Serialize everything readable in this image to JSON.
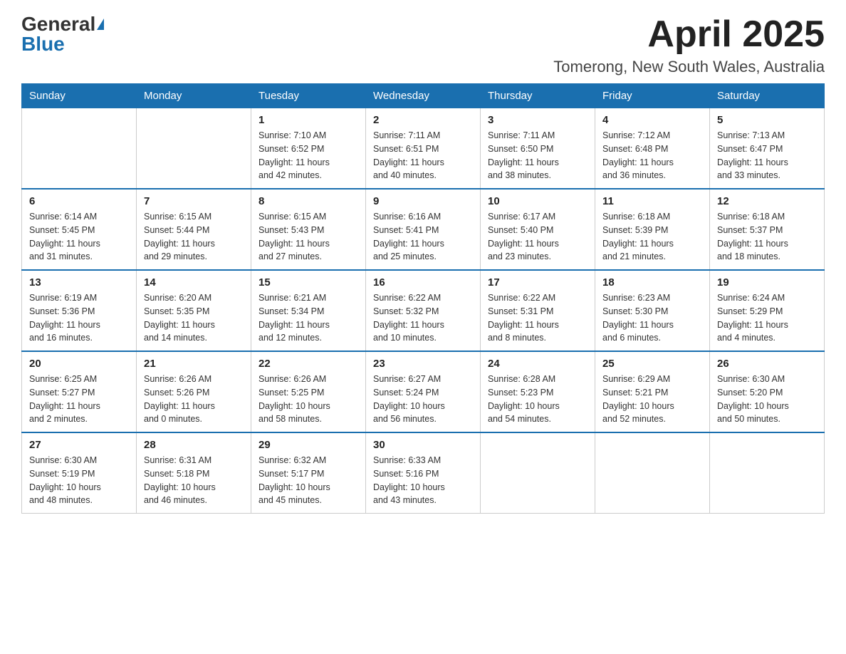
{
  "header": {
    "logo_general": "General",
    "logo_blue": "Blue",
    "title": "April 2025",
    "location": "Tomerong, New South Wales, Australia"
  },
  "weekdays": [
    "Sunday",
    "Monday",
    "Tuesday",
    "Wednesday",
    "Thursday",
    "Friday",
    "Saturday"
  ],
  "weeks": [
    [
      {
        "day": "",
        "info": ""
      },
      {
        "day": "",
        "info": ""
      },
      {
        "day": "1",
        "info": "Sunrise: 7:10 AM\nSunset: 6:52 PM\nDaylight: 11 hours\nand 42 minutes."
      },
      {
        "day": "2",
        "info": "Sunrise: 7:11 AM\nSunset: 6:51 PM\nDaylight: 11 hours\nand 40 minutes."
      },
      {
        "day": "3",
        "info": "Sunrise: 7:11 AM\nSunset: 6:50 PM\nDaylight: 11 hours\nand 38 minutes."
      },
      {
        "day": "4",
        "info": "Sunrise: 7:12 AM\nSunset: 6:48 PM\nDaylight: 11 hours\nand 36 minutes."
      },
      {
        "day": "5",
        "info": "Sunrise: 7:13 AM\nSunset: 6:47 PM\nDaylight: 11 hours\nand 33 minutes."
      }
    ],
    [
      {
        "day": "6",
        "info": "Sunrise: 6:14 AM\nSunset: 5:45 PM\nDaylight: 11 hours\nand 31 minutes."
      },
      {
        "day": "7",
        "info": "Sunrise: 6:15 AM\nSunset: 5:44 PM\nDaylight: 11 hours\nand 29 minutes."
      },
      {
        "day": "8",
        "info": "Sunrise: 6:15 AM\nSunset: 5:43 PM\nDaylight: 11 hours\nand 27 minutes."
      },
      {
        "day": "9",
        "info": "Sunrise: 6:16 AM\nSunset: 5:41 PM\nDaylight: 11 hours\nand 25 minutes."
      },
      {
        "day": "10",
        "info": "Sunrise: 6:17 AM\nSunset: 5:40 PM\nDaylight: 11 hours\nand 23 minutes."
      },
      {
        "day": "11",
        "info": "Sunrise: 6:18 AM\nSunset: 5:39 PM\nDaylight: 11 hours\nand 21 minutes."
      },
      {
        "day": "12",
        "info": "Sunrise: 6:18 AM\nSunset: 5:37 PM\nDaylight: 11 hours\nand 18 minutes."
      }
    ],
    [
      {
        "day": "13",
        "info": "Sunrise: 6:19 AM\nSunset: 5:36 PM\nDaylight: 11 hours\nand 16 minutes."
      },
      {
        "day": "14",
        "info": "Sunrise: 6:20 AM\nSunset: 5:35 PM\nDaylight: 11 hours\nand 14 minutes."
      },
      {
        "day": "15",
        "info": "Sunrise: 6:21 AM\nSunset: 5:34 PM\nDaylight: 11 hours\nand 12 minutes."
      },
      {
        "day": "16",
        "info": "Sunrise: 6:22 AM\nSunset: 5:32 PM\nDaylight: 11 hours\nand 10 minutes."
      },
      {
        "day": "17",
        "info": "Sunrise: 6:22 AM\nSunset: 5:31 PM\nDaylight: 11 hours\nand 8 minutes."
      },
      {
        "day": "18",
        "info": "Sunrise: 6:23 AM\nSunset: 5:30 PM\nDaylight: 11 hours\nand 6 minutes."
      },
      {
        "day": "19",
        "info": "Sunrise: 6:24 AM\nSunset: 5:29 PM\nDaylight: 11 hours\nand 4 minutes."
      }
    ],
    [
      {
        "day": "20",
        "info": "Sunrise: 6:25 AM\nSunset: 5:27 PM\nDaylight: 11 hours\nand 2 minutes."
      },
      {
        "day": "21",
        "info": "Sunrise: 6:26 AM\nSunset: 5:26 PM\nDaylight: 11 hours\nand 0 minutes."
      },
      {
        "day": "22",
        "info": "Sunrise: 6:26 AM\nSunset: 5:25 PM\nDaylight: 10 hours\nand 58 minutes."
      },
      {
        "day": "23",
        "info": "Sunrise: 6:27 AM\nSunset: 5:24 PM\nDaylight: 10 hours\nand 56 minutes."
      },
      {
        "day": "24",
        "info": "Sunrise: 6:28 AM\nSunset: 5:23 PM\nDaylight: 10 hours\nand 54 minutes."
      },
      {
        "day": "25",
        "info": "Sunrise: 6:29 AM\nSunset: 5:21 PM\nDaylight: 10 hours\nand 52 minutes."
      },
      {
        "day": "26",
        "info": "Sunrise: 6:30 AM\nSunset: 5:20 PM\nDaylight: 10 hours\nand 50 minutes."
      }
    ],
    [
      {
        "day": "27",
        "info": "Sunrise: 6:30 AM\nSunset: 5:19 PM\nDaylight: 10 hours\nand 48 minutes."
      },
      {
        "day": "28",
        "info": "Sunrise: 6:31 AM\nSunset: 5:18 PM\nDaylight: 10 hours\nand 46 minutes."
      },
      {
        "day": "29",
        "info": "Sunrise: 6:32 AM\nSunset: 5:17 PM\nDaylight: 10 hours\nand 45 minutes."
      },
      {
        "day": "30",
        "info": "Sunrise: 6:33 AM\nSunset: 5:16 PM\nDaylight: 10 hours\nand 43 minutes."
      },
      {
        "day": "",
        "info": ""
      },
      {
        "day": "",
        "info": ""
      },
      {
        "day": "",
        "info": ""
      }
    ]
  ]
}
